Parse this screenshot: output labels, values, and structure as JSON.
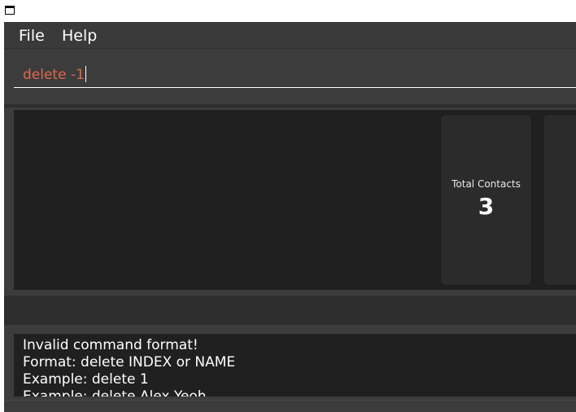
{
  "menu": {
    "file_label": "File",
    "help_label": "Help"
  },
  "command": {
    "value": "delete -1"
  },
  "dashboard": {
    "cards": [
      {
        "label": "Total Contacts",
        "value": "3"
      }
    ]
  },
  "result": {
    "lines": [
      "Invalid command format!",
      "Format: delete INDEX or NAME",
      "Example: delete 1",
      "Example: delete Alex Yeoh"
    ]
  },
  "colors": {
    "command_text": "#e0694c",
    "background": "#3c3c3c",
    "panel": "#202020"
  }
}
